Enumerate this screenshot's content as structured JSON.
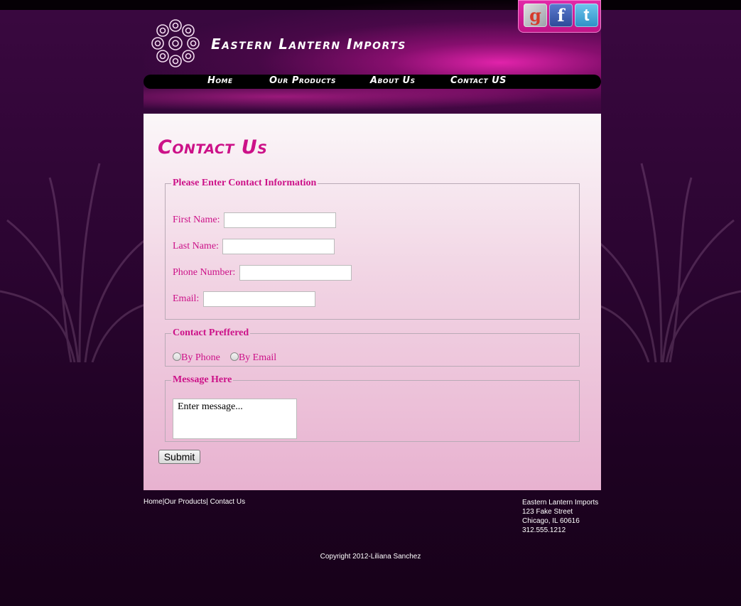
{
  "header": {
    "site_title": "Eastern Lantern Imports",
    "social": [
      {
        "name": "google-icon",
        "glyph": "g"
      },
      {
        "name": "facebook-icon",
        "glyph": "f"
      },
      {
        "name": "twitter-icon",
        "glyph": "t"
      }
    ]
  },
  "nav": {
    "items": [
      "Home",
      "Our Products",
      "About Us",
      "Contact US"
    ]
  },
  "main": {
    "heading": "Contact Us",
    "contact_info": {
      "legend": "Please Enter Contact Information",
      "first_name_label": "First Name:",
      "last_name_label": "Last Name:",
      "phone_label": "Phone Number:",
      "email_label": "Email:"
    },
    "contact_preferred": {
      "legend": "Contact Preffered",
      "options": [
        "By Phone",
        "By Email"
      ]
    },
    "message": {
      "legend": "Message Here",
      "value": "Enter message..."
    },
    "submit_label": "Submit"
  },
  "footer": {
    "links": [
      "Home",
      "Our Products",
      "Contact Us"
    ],
    "address": {
      "company": "Eastern Lantern Imports",
      "street": "123 Fake Street",
      "city": "Chicago, IL 60616",
      "phone": "312.555.1212"
    },
    "copyright": "Copyright 2012-Liliana Sanchez"
  },
  "colors": {
    "accent": "#cc1188",
    "background": "#2c0532"
  }
}
